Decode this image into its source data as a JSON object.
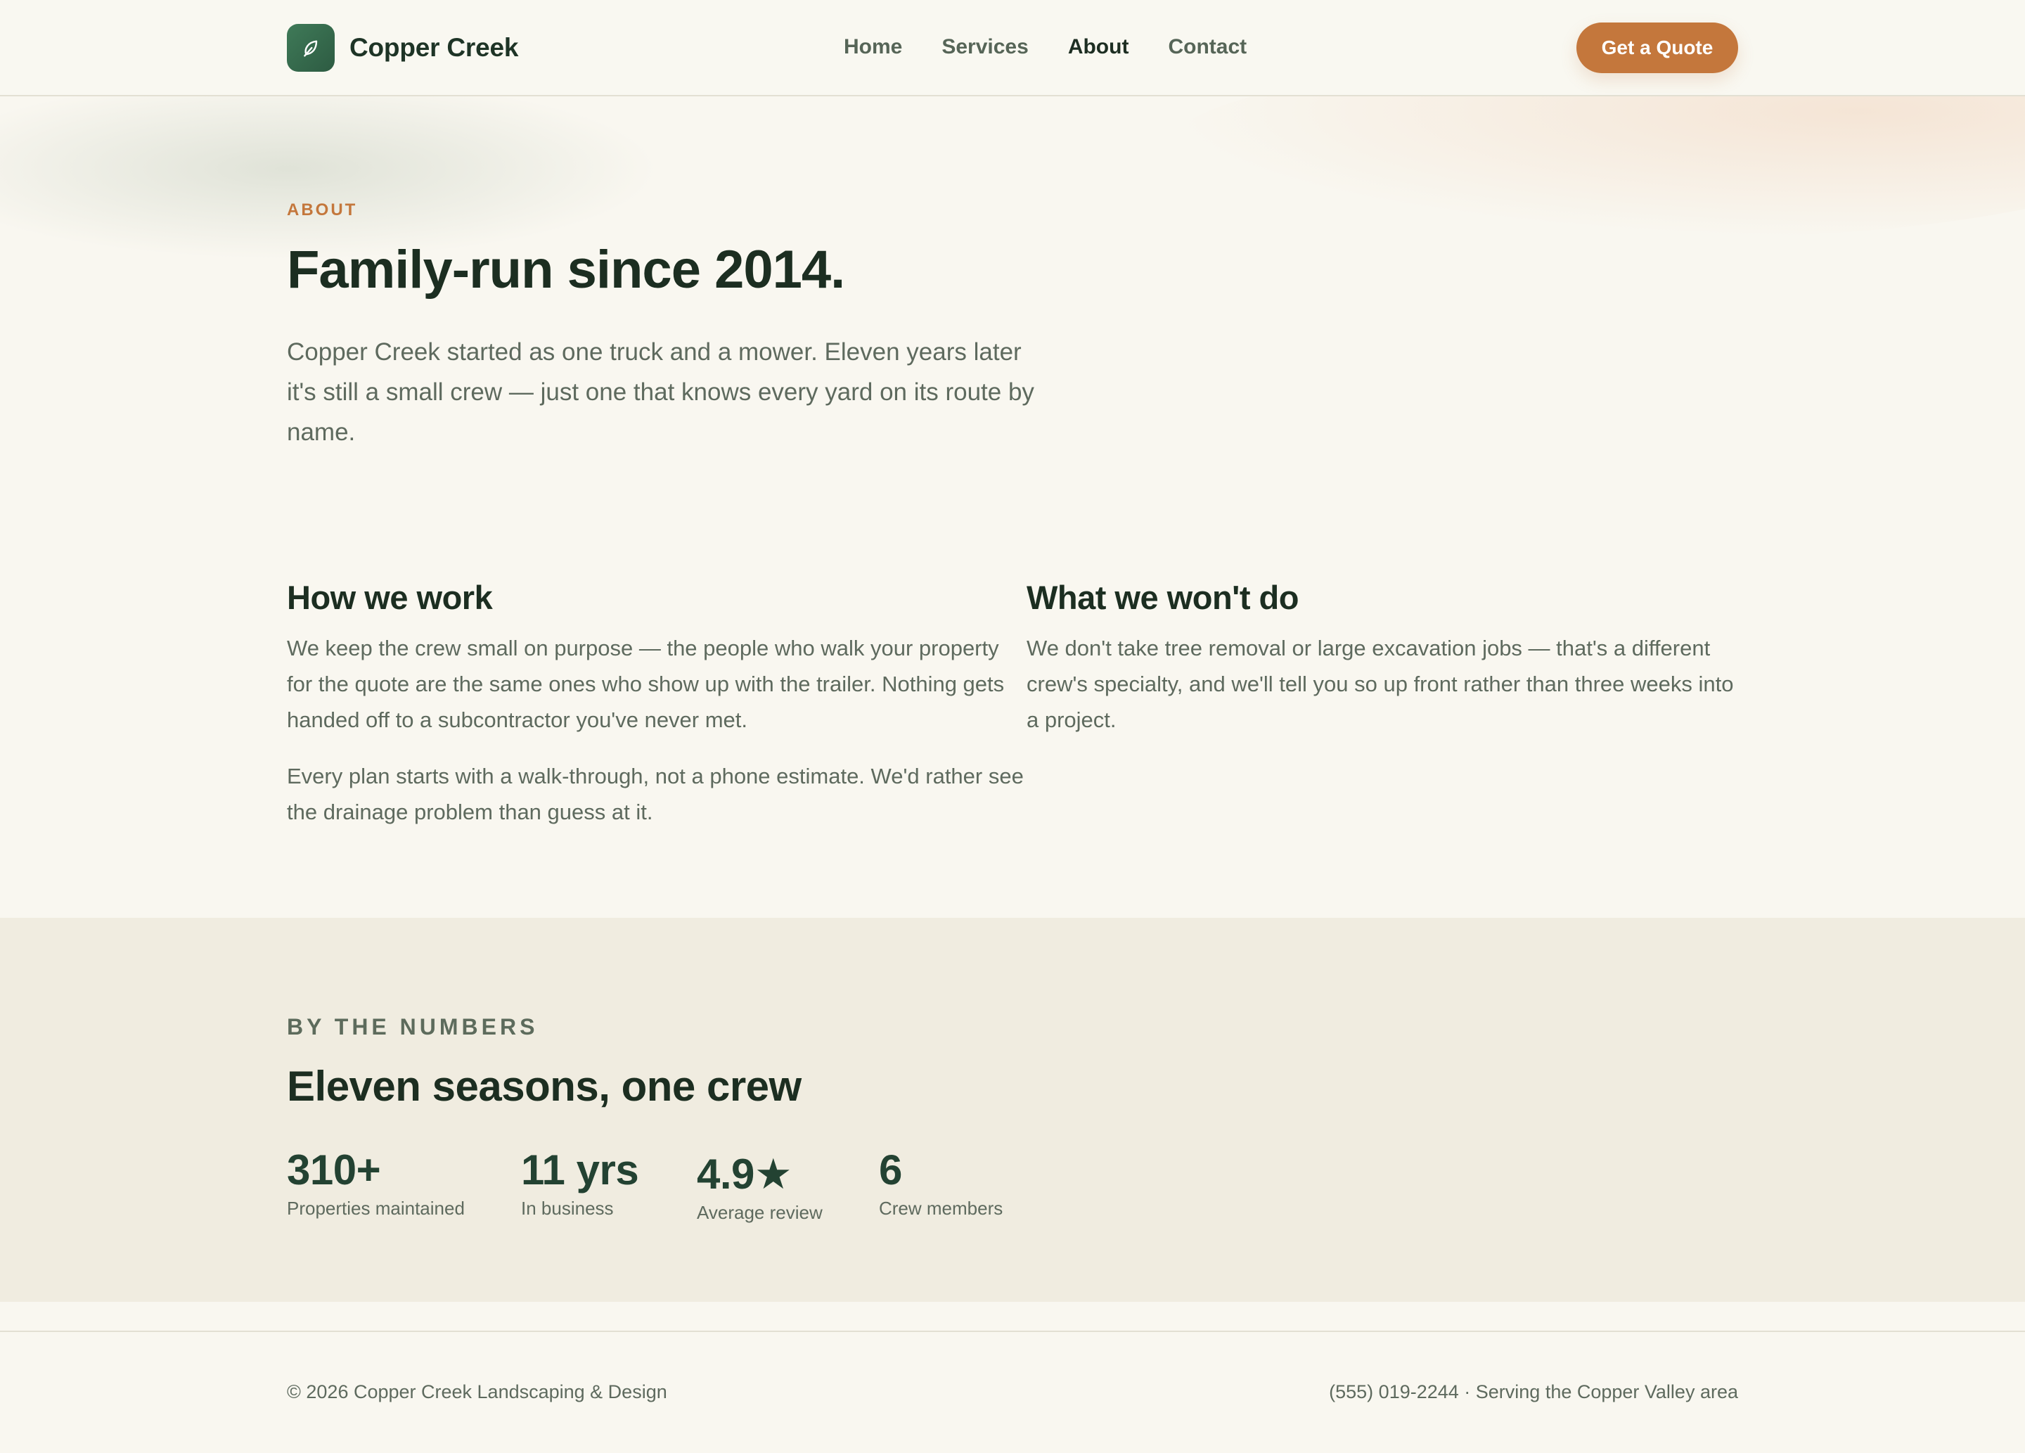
{
  "header": {
    "brand_name": "Copper Creek",
    "logo_icon": "leaf-icon",
    "nav": [
      {
        "label": "Home",
        "active": false
      },
      {
        "label": "Services",
        "active": false
      },
      {
        "label": "About",
        "active": true
      },
      {
        "label": "Contact",
        "active": false
      }
    ],
    "cta_label": "Get a Quote"
  },
  "hero": {
    "eyebrow": "ABOUT",
    "title": "Family-run since 2014.",
    "lead": "Copper Creek started as one truck and a mower. Eleven years later it's still a small crew — just one that knows every yard on its route by name."
  },
  "columns": {
    "how_we_work": {
      "title": "How we work",
      "paragraphs": [
        "We keep the crew small on purpose — the people who walk your property for the quote are the same ones who show up with the trailer. Nothing gets handed off to a subcontractor you've never met.",
        "Every plan starts with a walk-through, not a phone estimate. We'd rather see the drainage problem than guess at it."
      ]
    },
    "what_we_wont_do": {
      "title": "What we won't do",
      "paragraphs": [
        "We don't take tree removal or large excavation jobs — that's a different crew's specialty, and we'll tell you so up front rather than three weeks into a project."
      ]
    }
  },
  "numbers": {
    "eyebrow": "BY THE NUMBERS",
    "title": "Eleven seasons, one crew",
    "stats": [
      {
        "value": "310+",
        "label": "Properties maintained"
      },
      {
        "value": "11 yrs",
        "label": "In business"
      },
      {
        "value": "4.9★",
        "label": "Average review"
      },
      {
        "value": "6",
        "label": "Crew members"
      }
    ]
  },
  "footer": {
    "copyright": "© 2026 Copper Creek Landscaping & Design",
    "contact": "(555) 019-2244 · Serving the Copper Valley area"
  },
  "colors": {
    "accent": "#c4773c",
    "brand_green": "#2d5b42",
    "background": "#f9f7f0",
    "band_background": "#f0ece0",
    "heading": "#1c2e21",
    "body_text": "#5e6a5e"
  }
}
